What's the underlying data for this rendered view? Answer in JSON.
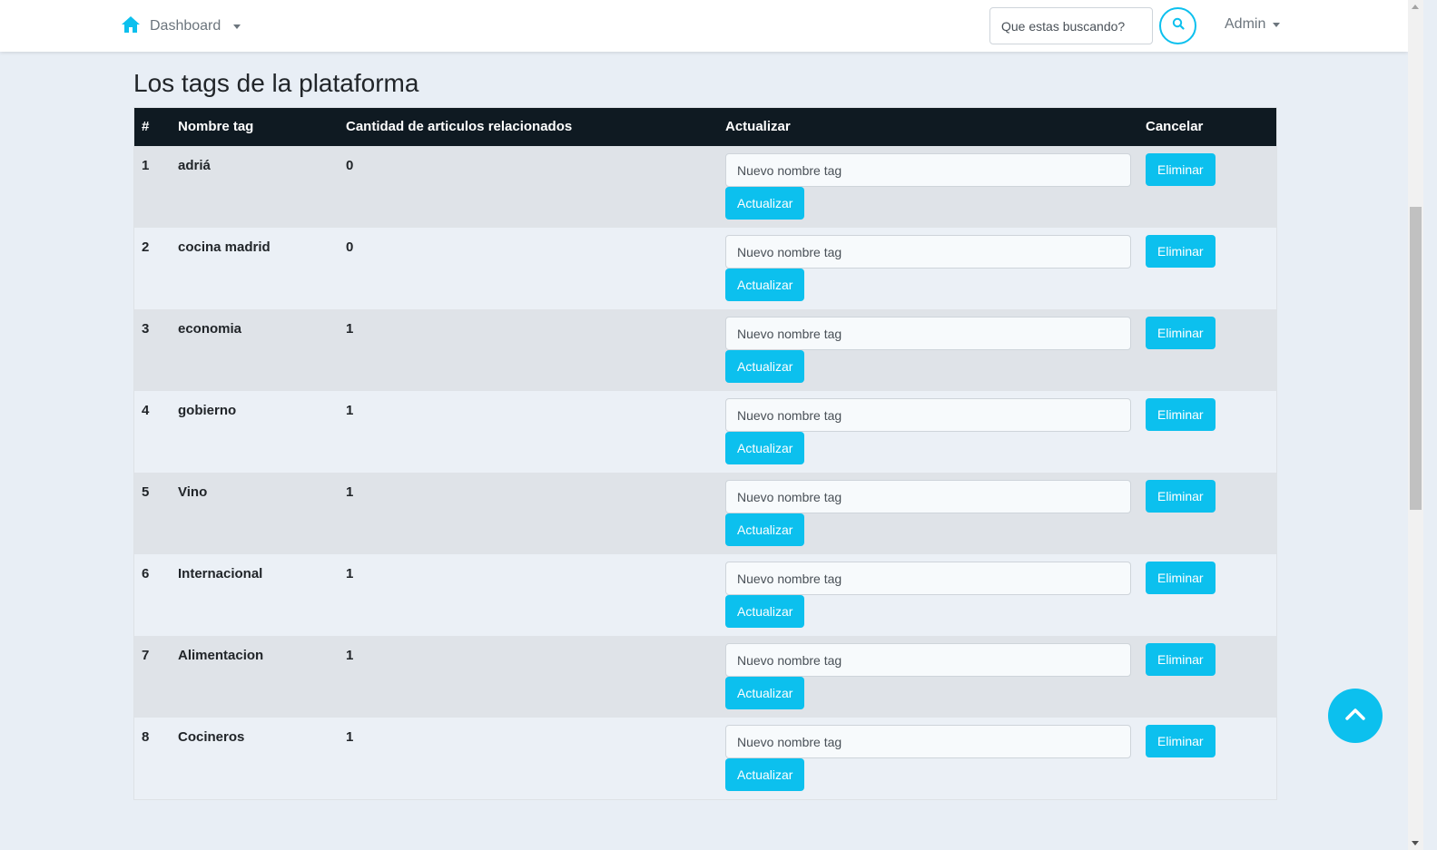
{
  "navbar": {
    "brand_label": "Dashboard",
    "search_placeholder": "Que estas buscando?",
    "user_label": "Admin"
  },
  "page": {
    "title": "Los tags de la plataforma"
  },
  "table": {
    "headers": [
      "#",
      "Nombre tag",
      "Cantidad de articulos relacionados",
      "Actualizar",
      "Cancelar"
    ],
    "input_placeholder": "Nuevo nombre tag",
    "update_label": "Actualizar",
    "delete_label": "Eliminar",
    "rows": [
      {
        "id": "1",
        "name": "adriá",
        "count": "0"
      },
      {
        "id": "2",
        "name": "cocina madrid",
        "count": "0"
      },
      {
        "id": "3",
        "name": "economia",
        "count": "1"
      },
      {
        "id": "4",
        "name": "gobierno",
        "count": "1"
      },
      {
        "id": "5",
        "name": "Vino",
        "count": "1"
      },
      {
        "id": "6",
        "name": "Internacional",
        "count": "1"
      },
      {
        "id": "7",
        "name": "Alimentacion",
        "count": "1"
      },
      {
        "id": "8",
        "name": "Cocineros",
        "count": "1"
      }
    ]
  },
  "colors": {
    "accent": "#0cc0ee",
    "header_bg": "#0f1a22",
    "page_bg": "#e8eef5"
  },
  "icons": {
    "brand": "home-icon",
    "search": "search-icon",
    "scroll_top": "chevron-up-icon"
  }
}
